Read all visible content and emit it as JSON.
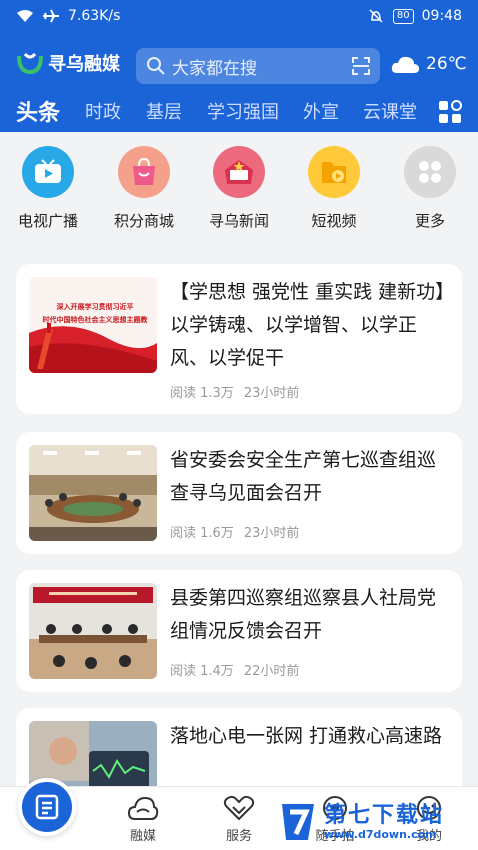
{
  "status_bar": {
    "speed": "7.63K/s",
    "battery": "80",
    "time": "09:48"
  },
  "header": {
    "app_name": "寻乌融媒",
    "search_placeholder": "大家都在搜",
    "temperature": "26℃"
  },
  "tabs": [
    {
      "label": "头条",
      "active": true
    },
    {
      "label": "时政"
    },
    {
      "label": "基层"
    },
    {
      "label": "学习强国"
    },
    {
      "label": "外宣"
    },
    {
      "label": "云课堂"
    }
  ],
  "quick_links": [
    {
      "label": "电视广播",
      "icon": "tv-icon",
      "color": "#29a8e8"
    },
    {
      "label": "积分商城",
      "icon": "shopping-bag-icon",
      "color": "#f07a6a"
    },
    {
      "label": "寻乌新闻",
      "icon": "news-icon",
      "color": "#ea4e60"
    },
    {
      "label": "短视频",
      "icon": "video-folder-icon",
      "color": "#f5b800"
    },
    {
      "label": "更多",
      "icon": "more-grid-icon",
      "color": "#d8d8d8"
    }
  ],
  "articles": [
    {
      "title": "【学思想 强党性 重实践 建新功】以学铸魂、以学增智、以学正风、以学促干",
      "reads": "阅读 1.3万",
      "time": "23小时前",
      "thumb_banner": "深入开展学习贯彻习近平\n时代中国特色社会主义思想主题教"
    },
    {
      "title": "省安委会安全生产第七巡查组巡查寻乌见面会召开",
      "reads": "阅读 1.6万",
      "time": "23小时前"
    },
    {
      "title": "县委第四巡察组巡察县人社局党组情况反馈会召开",
      "reads": "阅读 1.4万",
      "time": "22小时前"
    },
    {
      "title": "落地心电一张网 打通救心高速路",
      "reads": "",
      "time": ""
    }
  ],
  "bottom_nav": [
    {
      "label": "融媒",
      "icon": "cloud-icon"
    },
    {
      "label": "服务",
      "icon": "handshake-icon"
    },
    {
      "label": "随手拍",
      "icon": "camera-icon"
    },
    {
      "label": "我的",
      "icon": "profile-icon"
    }
  ],
  "watermark": {
    "cn": "第七下载站",
    "url": "www.d7down.com"
  },
  "colors": {
    "brand": "#1a64d8",
    "card_bg": "#ffffff",
    "page_bg": "#f2f3f5"
  }
}
